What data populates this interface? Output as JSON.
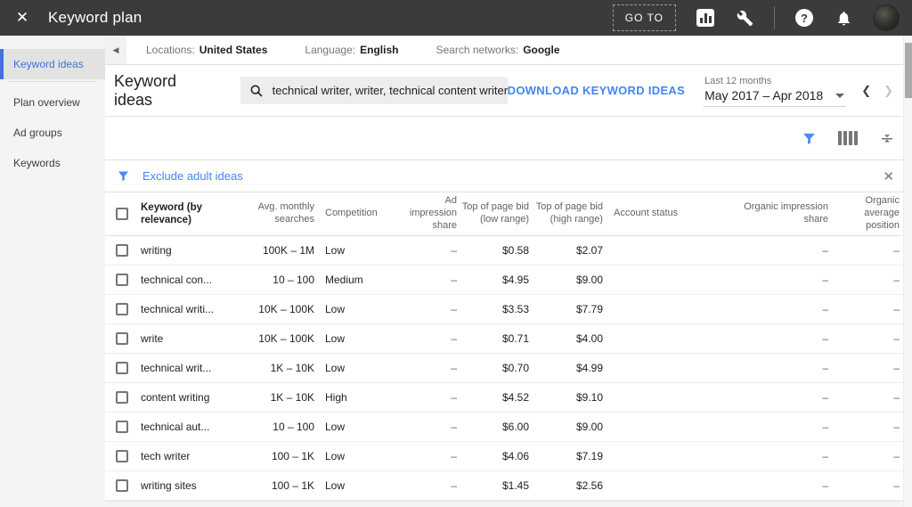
{
  "topbar": {
    "title": "Keyword plan",
    "go_to_label": "GO TO"
  },
  "icons": {
    "close": "✕",
    "collapse_panel": "◀",
    "prev_chevron": "❮",
    "next_chevron": "❯",
    "help": "?",
    "clear_filter": "✕"
  },
  "sidebar": {
    "items": [
      {
        "label": "Keyword ideas",
        "active": true
      },
      {
        "label": "Plan overview",
        "active": false
      },
      {
        "label": "Ad groups",
        "active": false
      },
      {
        "label": "Keywords",
        "active": false
      }
    ]
  },
  "settings_bar": {
    "items": [
      {
        "label": "Locations:",
        "value": "United States"
      },
      {
        "label": "Language:",
        "value": "English"
      },
      {
        "label": "Search networks:",
        "value": "Google"
      }
    ]
  },
  "toolbar": {
    "heading": "Keyword ideas",
    "search_value": "technical writer, writer, technical content writer",
    "download_label": "DOWNLOAD KEYWORD IDEAS",
    "date_preset": "Last 12 months",
    "date_range": "May 2017 – Apr 2018"
  },
  "filter_bar": {
    "chip_label": "Exclude adult ideas"
  },
  "table": {
    "headers": [
      "Keyword (by relevance)",
      "Avg. monthly searches",
      "Competition",
      "Ad impression share",
      "Top of page bid (low range)",
      "Top of page bid (high range)",
      "Account status",
      "Organic impression share",
      "Organic average position"
    ],
    "rows": [
      {
        "keyword": "writing",
        "searches": "100K – 1M",
        "competition": "Low",
        "ad_impression_share": "–",
        "top_bid_low": "$0.58",
        "top_bid_high": "$2.07",
        "account_status": "",
        "organic_impression_share": "–",
        "organic_avg_position": "–"
      },
      {
        "keyword": "technical con...",
        "searches": "10 – 100",
        "competition": "Medium",
        "ad_impression_share": "–",
        "top_bid_low": "$4.95",
        "top_bid_high": "$9.00",
        "account_status": "",
        "organic_impression_share": "–",
        "organic_avg_position": "–"
      },
      {
        "keyword": "technical writi...",
        "searches": "10K – 100K",
        "competition": "Low",
        "ad_impression_share": "–",
        "top_bid_low": "$3.53",
        "top_bid_high": "$7.79",
        "account_status": "",
        "organic_impression_share": "–",
        "organic_avg_position": "–"
      },
      {
        "keyword": "write",
        "searches": "10K – 100K",
        "competition": "Low",
        "ad_impression_share": "–",
        "top_bid_low": "$0.71",
        "top_bid_high": "$4.00",
        "account_status": "",
        "organic_impression_share": "–",
        "organic_avg_position": "–"
      },
      {
        "keyword": "technical writ...",
        "searches": "1K – 10K",
        "competition": "Low",
        "ad_impression_share": "–",
        "top_bid_low": "$0.70",
        "top_bid_high": "$4.99",
        "account_status": "",
        "organic_impression_share": "–",
        "organic_avg_position": "–"
      },
      {
        "keyword": "content writing",
        "searches": "1K – 10K",
        "competition": "High",
        "ad_impression_share": "–",
        "top_bid_low": "$4.52",
        "top_bid_high": "$9.10",
        "account_status": "",
        "organic_impression_share": "–",
        "organic_avg_position": "–"
      },
      {
        "keyword": "technical aut...",
        "searches": "10 – 100",
        "competition": "Low",
        "ad_impression_share": "–",
        "top_bid_low": "$6.00",
        "top_bid_high": "$9.00",
        "account_status": "",
        "organic_impression_share": "–",
        "organic_avg_position": "–"
      },
      {
        "keyword": "tech writer",
        "searches": "100 – 1K",
        "competition": "Low",
        "ad_impression_share": "–",
        "top_bid_low": "$4.06",
        "top_bid_high": "$7.19",
        "account_status": "",
        "organic_impression_share": "–",
        "organic_avg_position": "–"
      },
      {
        "keyword": "writing sites",
        "searches": "100 – 1K",
        "competition": "Low",
        "ad_impression_share": "–",
        "top_bid_low": "$1.45",
        "top_bid_high": "$2.56",
        "account_status": "",
        "organic_impression_share": "–",
        "organic_avg_position": "–"
      }
    ]
  },
  "colors": {
    "topbar_bg": "#3b3b3b",
    "accent_blue": "#4285f4",
    "text_primary": "#212121",
    "text_secondary": "#757575",
    "border": "#e0e0e0"
  }
}
